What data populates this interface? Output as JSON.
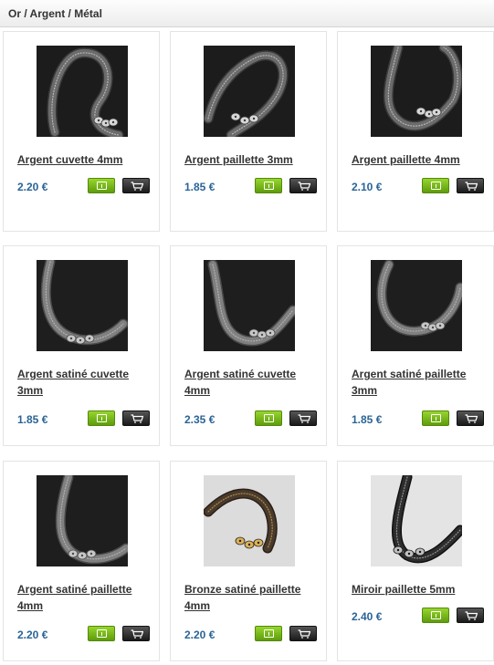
{
  "breadcrumb": "Or / Argent / Métal",
  "colors": {
    "price": "#2a6496",
    "info_button": "#7bbd1c",
    "cart_button": "#2b2b2b"
  },
  "products": [
    {
      "name": "Argent cuvette 4mm",
      "price": "2.20 €",
      "image": "silver-sequin-strand",
      "info_icon": "info-icon",
      "cart_icon": "cart-icon"
    },
    {
      "name": "Argent paillette 3mm",
      "price": "1.85 €",
      "image": "silver-sequin-strand",
      "info_icon": "info-icon",
      "cart_icon": "cart-icon"
    },
    {
      "name": "Argent paillette 4mm",
      "price": "2.10 €",
      "image": "silver-sequin-strand",
      "info_icon": "info-icon",
      "cart_icon": "cart-icon"
    },
    {
      "name": "Argent satiné cuvette 3mm",
      "price": "1.85 €",
      "image": "satin-silver-sequin-strand",
      "info_icon": "info-icon",
      "cart_icon": "cart-icon"
    },
    {
      "name": "Argent satiné cuvette 4mm",
      "price": "2.35 €",
      "image": "satin-silver-sequin-strand",
      "info_icon": "info-icon",
      "cart_icon": "cart-icon"
    },
    {
      "name": "Argent satiné paillette 3mm",
      "price": "1.85 €",
      "image": "satin-silver-sequin-strand",
      "info_icon": "info-icon",
      "cart_icon": "cart-icon"
    },
    {
      "name": "Argent satiné paillette 4mm",
      "price": "2.20 €",
      "image": "satin-silver-sequin-strand",
      "info_icon": "info-icon",
      "cart_icon": "cart-icon"
    },
    {
      "name": "Bronze satiné paillette 4mm",
      "price": "2.20 €",
      "image": "bronze-sequin-strand",
      "info_icon": "info-icon",
      "cart_icon": "cart-icon"
    },
    {
      "name": "Miroir paillette 5mm",
      "price": "2.40 €",
      "image": "mirror-sequin-strand",
      "info_icon": "info-icon",
      "cart_icon": "cart-icon"
    }
  ]
}
